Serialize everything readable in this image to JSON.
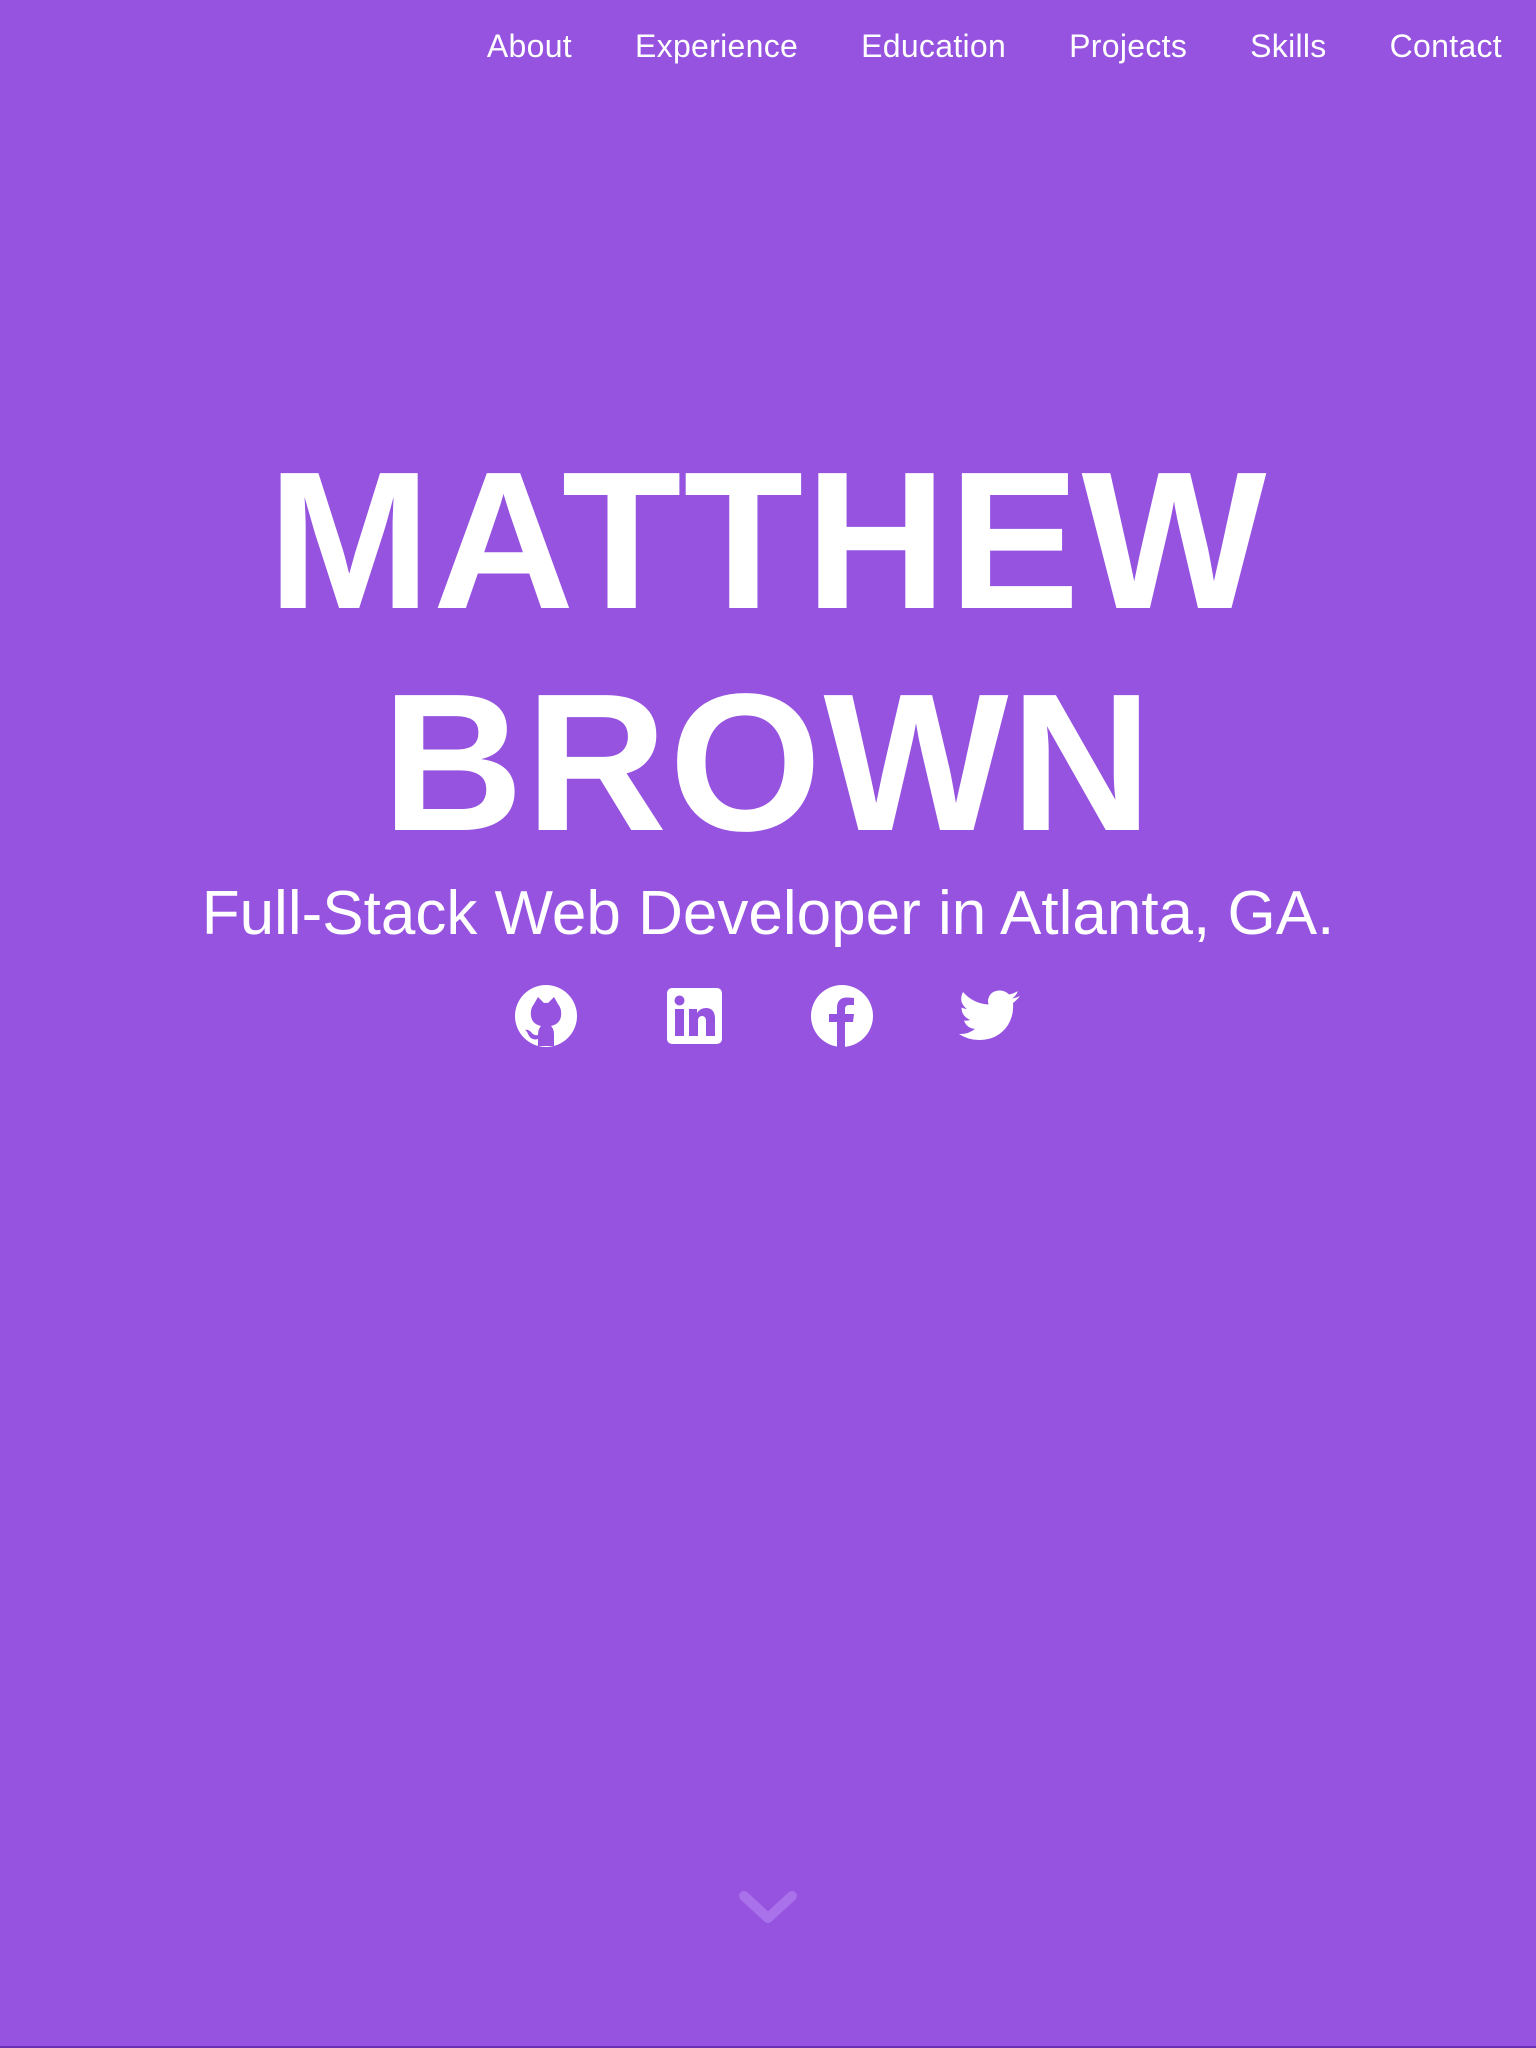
{
  "colors": {
    "background": "#9653e0",
    "text": "#ffffff",
    "scroll_icon": "#a971ea"
  },
  "nav": {
    "items": [
      {
        "label": "About"
      },
      {
        "label": "Experience"
      },
      {
        "label": "Education"
      },
      {
        "label": "Projects"
      },
      {
        "label": "Skills"
      },
      {
        "label": "Contact"
      }
    ]
  },
  "hero": {
    "name_line1": "MATTHEW",
    "name_line2": "BROWN",
    "tagline": "Full-Stack Web Developer in Atlanta, GA."
  },
  "social": [
    {
      "icon": "github-icon"
    },
    {
      "icon": "linkedin-icon"
    },
    {
      "icon": "facebook-icon"
    },
    {
      "icon": "twitter-icon"
    }
  ],
  "scroll_indicator": {
    "icon": "chevron-down-icon"
  }
}
